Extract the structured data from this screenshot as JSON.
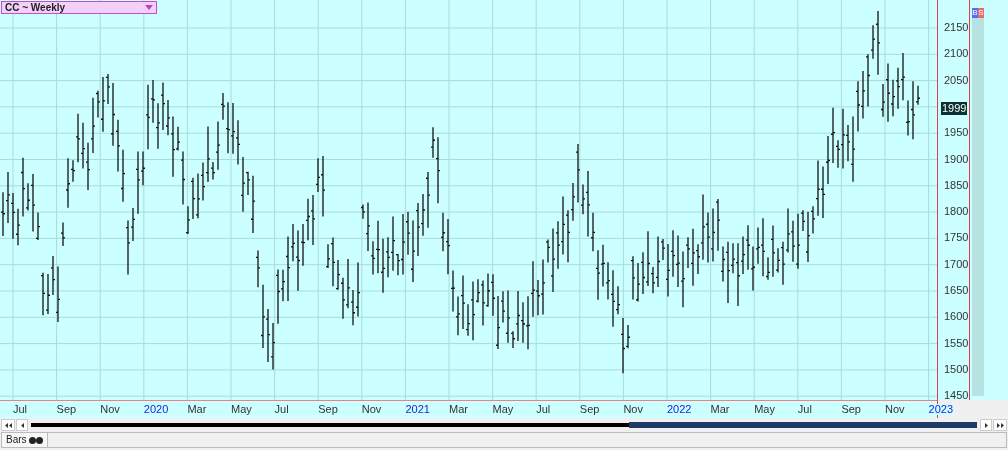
{
  "symbol_selector": {
    "label": "CC ~ Weekly"
  },
  "side_buttons": [
    {
      "label": "B",
      "color": "#5a6cf0"
    },
    {
      "label": "S",
      "color": "#e86a6a"
    }
  ],
  "price_axis": {
    "labels": [
      {
        "text": "2150",
        "kind": "tick"
      },
      {
        "text": "2100",
        "kind": "tick"
      },
      {
        "text": "2050",
        "kind": "tick"
      },
      {
        "text": "1999",
        "kind": "last_price"
      },
      {
        "text": "1950",
        "kind": "tick"
      },
      {
        "text": "1900",
        "kind": "tick"
      },
      {
        "text": "1850",
        "kind": "tick"
      },
      {
        "text": "1800",
        "kind": "tick"
      },
      {
        "text": "1750",
        "kind": "tick"
      },
      {
        "text": "1700",
        "kind": "tick"
      },
      {
        "text": "1650",
        "kind": "tick"
      },
      {
        "text": "1600",
        "kind": "tick"
      },
      {
        "text": "1550",
        "kind": "tick"
      },
      {
        "text": "1500",
        "kind": "tick"
      },
      {
        "text": "1450",
        "kind": "tick"
      }
    ]
  },
  "time_axis": {
    "labels": [
      {
        "text": "Jul",
        "kind": "month"
      },
      {
        "text": "Sep",
        "kind": "month"
      },
      {
        "text": "Nov",
        "kind": "month"
      },
      {
        "text": "2020",
        "kind": "year"
      },
      {
        "text": "Mar",
        "kind": "month"
      },
      {
        "text": "May",
        "kind": "month"
      },
      {
        "text": "Jul",
        "kind": "month"
      },
      {
        "text": "Sep",
        "kind": "month"
      },
      {
        "text": "Nov",
        "kind": "month"
      },
      {
        "text": "2021",
        "kind": "year"
      },
      {
        "text": "Mar",
        "kind": "month"
      },
      {
        "text": "May",
        "kind": "month"
      },
      {
        "text": "Jul",
        "kind": "month"
      },
      {
        "text": "Sep",
        "kind": "month"
      },
      {
        "text": "Nov",
        "kind": "month"
      },
      {
        "text": "2022",
        "kind": "year"
      },
      {
        "text": "Mar",
        "kind": "month"
      },
      {
        "text": "May",
        "kind": "month"
      },
      {
        "text": "Jul",
        "kind": "month"
      },
      {
        "text": "Sep",
        "kind": "month"
      },
      {
        "text": "Nov",
        "kind": "month"
      },
      {
        "text": "2023",
        "kind": "year"
      }
    ]
  },
  "bottom_tab": {
    "label": "Bars"
  }
}
